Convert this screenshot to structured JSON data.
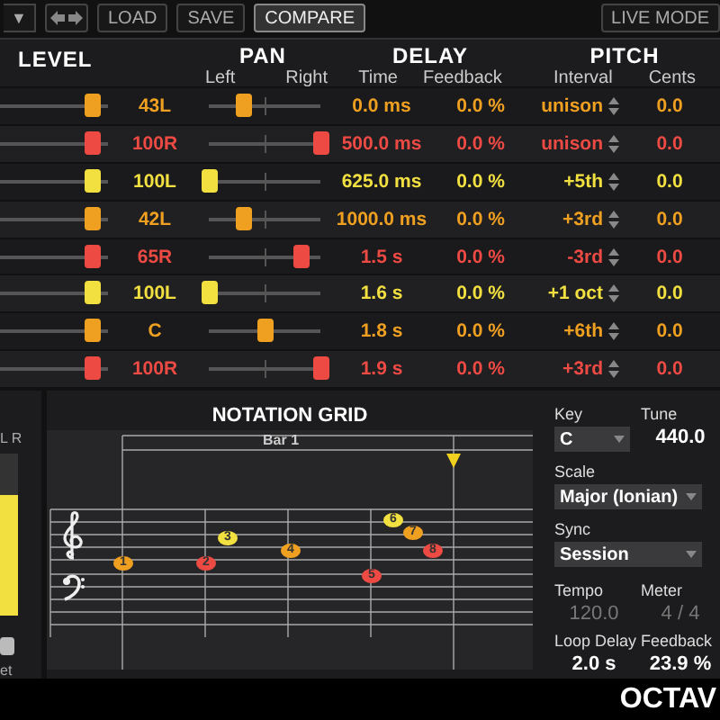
{
  "toolbar": {
    "preset_arrow": "▼",
    "buttons": [
      {
        "label": "LOAD",
        "selected": false
      },
      {
        "label": "SAVE",
        "selected": false
      },
      {
        "label": "COMPARE",
        "selected": true
      }
    ],
    "live_mode": "LIVE MODE"
  },
  "headers": {
    "level": "LEVEL",
    "pan": "PAN",
    "delay": "DELAY",
    "pitch": "PITCH",
    "pan_left": "Left",
    "pan_right": "Right",
    "time": "Time",
    "feedback": "Feedback",
    "interval": "Interval",
    "cents": "Cents"
  },
  "taps": [
    {
      "color": "#f0a020",
      "level": 0.85,
      "pan": "43L",
      "pan_slider": {
        "level": 0.3
      },
      "time": "0.0 ms",
      "feedback": "0.0 %",
      "interval": "unison",
      "cents": "0.0"
    },
    {
      "color": "#ee4a44",
      "level": 0.85,
      "pan": "100R",
      "pan_slider": {
        "level": 1
      },
      "time": "500.0 ms",
      "feedback": "0.0 %",
      "interval": "unison",
      "cents": "0.0"
    },
    {
      "color": "#f2e040",
      "level": 0.85,
      "pan": "100L",
      "pan_slider": {
        "level": 0
      },
      "time": "625.0 ms",
      "feedback": "0.0 %",
      "interval": "+5th",
      "cents": "0.0"
    },
    {
      "color": "#f0a020",
      "level": 0.85,
      "pan": "42L",
      "pan_slider": {
        "level": 0.3
      },
      "time": "1000.0 ms",
      "feedback": "0.0 %",
      "interval": "+3rd",
      "cents": "0.0"
    },
    {
      "color": "#ee4a44",
      "level": 0.85,
      "pan": "65R",
      "pan_slider": {
        "level": 0.82
      },
      "time": "1.5 s",
      "feedback": "0.0 %",
      "interval": "-3rd",
      "cents": "0.0"
    },
    {
      "color": "#f2e040",
      "level": 0.85,
      "pan": "100L",
      "pan_slider": {
        "level": 0
      },
      "time": "1.6 s",
      "feedback": "0.0 %",
      "interval": "+1 oct",
      "cents": "0.0"
    },
    {
      "color": "#f0a020",
      "level": 0.85,
      "pan": "C",
      "pan_slider": {
        "level": 0.5
      },
      "time": "1.8 s",
      "feedback": "0.0 %",
      "interval": "+6th",
      "cents": "0.0"
    },
    {
      "color": "#ee4a44",
      "level": 0.85,
      "pan": "100R",
      "pan_slider": {
        "level": 1
      },
      "time": "1.9 s",
      "feedback": "0.0 %",
      "interval": "+3rd",
      "cents": "0.0"
    }
  ],
  "meter": {
    "label": "L R",
    "level": 0.75,
    "button_text": "et"
  },
  "notation_grid": {
    "title": "NOTATION GRID",
    "bar": "Bar 1",
    "notes": [
      {
        "label": "1",
        "color": "#f0a020"
      },
      {
        "label": "2",
        "color": "#ee4a44"
      },
      {
        "label": "3",
        "color": "#f2e040"
      },
      {
        "label": "4",
        "color": "#f0a020"
      },
      {
        "label": "5",
        "color": "#ee4a44"
      },
      {
        "label": "6",
        "color": "#f2e040"
      },
      {
        "label": "7",
        "color": "#f0a020"
      },
      {
        "label": "8",
        "color": "#ee4a44"
      }
    ]
  },
  "settings": {
    "key_label": "Key",
    "key": "C",
    "tune_label": "Tune",
    "tune": "440.0",
    "scale_label": "Scale",
    "scale": "Major (Ionian)",
    "sync_label": "Sync",
    "sync": "Session",
    "tempo_label": "Tempo",
    "tempo": "120.0",
    "meter_label": "Meter",
    "meter": "4 / 4",
    "tempo_disabled": true,
    "loop_delay_label": "Loop Delay",
    "loop_delay": "2.0 s",
    "feedback_label": "Feedback",
    "feedback": "23.9 %"
  },
  "logo": "OCTAV"
}
